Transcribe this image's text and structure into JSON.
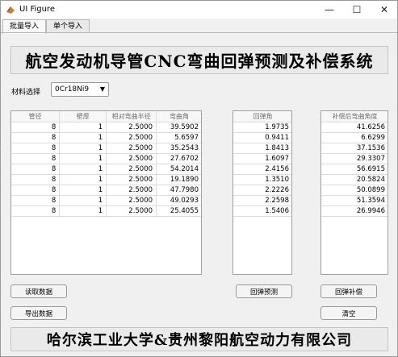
{
  "window": {
    "title": "UI Figure",
    "controls": {
      "minimize": "—",
      "maximize": "☐",
      "close": "✕"
    }
  },
  "tabs": [
    {
      "label": "批量导入",
      "active": true
    },
    {
      "label": "单个导入",
      "active": false
    }
  ],
  "header_title": "航空发动机导管CNC弯曲回弹预测及补偿系统",
  "material": {
    "label": "材料选择",
    "value": "0Cr18Ni9"
  },
  "input_table": {
    "columns": [
      "管径",
      "壁厚",
      "相对弯曲半径",
      "弯曲角"
    ],
    "rows": [
      [
        "8",
        "1",
        "2.5000",
        "39.5902"
      ],
      [
        "8",
        "1",
        "2.5000",
        "5.6597"
      ],
      [
        "8",
        "1",
        "2.5000",
        "35.2543"
      ],
      [
        "8",
        "1",
        "2.5000",
        "27.6702"
      ],
      [
        "8",
        "1",
        "2.5000",
        "54.2014"
      ],
      [
        "8",
        "1",
        "2.5000",
        "19.1890"
      ],
      [
        "8",
        "1",
        "2.5000",
        "47.7980"
      ],
      [
        "8",
        "1",
        "2.5000",
        "49.0293"
      ],
      [
        "8",
        "1",
        "2.5000",
        "25.4055"
      ]
    ]
  },
  "springback_table": {
    "columns": [
      "回弹角"
    ],
    "rows": [
      [
        "1.9735"
      ],
      [
        "0.9411"
      ],
      [
        "1.8413"
      ],
      [
        "1.6097"
      ],
      [
        "2.4156"
      ],
      [
        "1.3510"
      ],
      [
        "2.2226"
      ],
      [
        "2.2598"
      ],
      [
        "1.5406"
      ]
    ]
  },
  "compensated_table": {
    "columns": [
      "补偿后弯曲角度"
    ],
    "rows": [
      [
        "41.6256"
      ],
      [
        "6.6299"
      ],
      [
        "37.1536"
      ],
      [
        "29.3307"
      ],
      [
        "56.6915"
      ],
      [
        "20.5824"
      ],
      [
        "50.0899"
      ],
      [
        "51.3594"
      ],
      [
        "26.9946"
      ]
    ]
  },
  "buttons": {
    "read_data": "读取数据",
    "export_data": "导出数据",
    "predict": "回弹预测",
    "compensate": "回弹补偿",
    "clear": "清空"
  },
  "footer_text": "哈尔滨工业大学&贵州黎阳航空动力有限公司",
  "colors": {
    "banner_bg": "#eaeaea",
    "table_header_text": "#707070",
    "window_bg": "#f0f0f0"
  }
}
